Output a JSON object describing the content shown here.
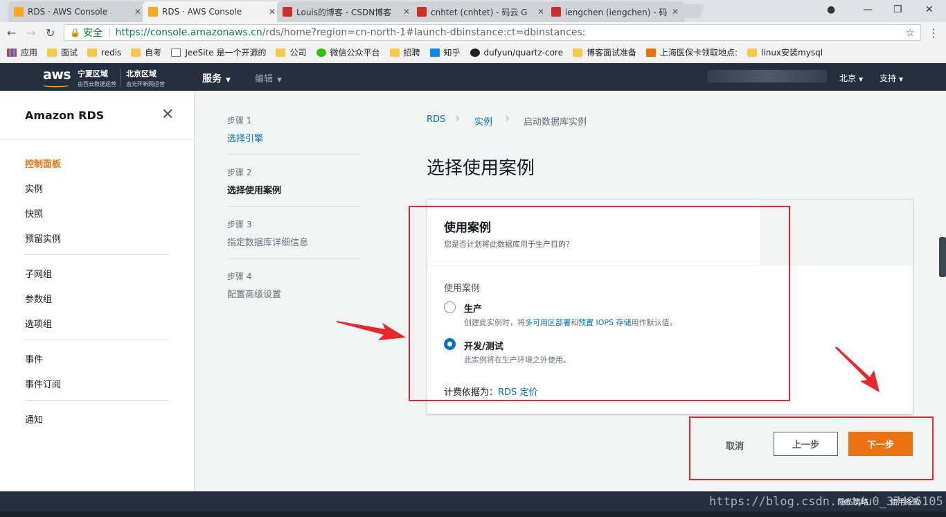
{
  "browser": {
    "tabs": [
      {
        "title": "RDS · AWS Console",
        "favicon": "#f9a825",
        "active": false
      },
      {
        "title": "RDS · AWS Console",
        "favicon": "#f9a825",
        "active": true
      },
      {
        "title": "Louis的博客 - CSDN博客",
        "favicon": "#c9302c",
        "active": false
      },
      {
        "title": "cnhtet (cnhtet) - 码云 G",
        "favicon": "#c9302c",
        "active": false
      },
      {
        "title": "iengchen (iengchen) - 码",
        "favicon": "#c9302c",
        "active": false
      }
    ],
    "secure_label": "安全",
    "url_host": "https://console.amazonaws.cn",
    "url_path": "/rds/home?region=cn-north-1#launch-dbinstance:ct=dbinstances:",
    "bookmarks": [
      {
        "label": "应用",
        "icon": "grid"
      },
      {
        "label": "面试",
        "icon": "folder"
      },
      {
        "label": "redis",
        "icon": "folder"
      },
      {
        "label": "自考",
        "icon": "folder"
      },
      {
        "label": "JeeSite 是一个开源的",
        "icon": "doc"
      },
      {
        "label": "公司",
        "icon": "folder"
      },
      {
        "label": "微信公众平台",
        "icon": "wechat"
      },
      {
        "label": "招聘",
        "icon": "folder"
      },
      {
        "label": "知乎",
        "icon": "zhi"
      },
      {
        "label": "dufyun/quartz-core",
        "icon": "gh"
      },
      {
        "label": "博客面试准备",
        "icon": "folder"
      },
      {
        "label": "上海医保卡领取地点:",
        "icon": "ho"
      },
      {
        "label": "linux安装mysql",
        "icon": "folder"
      }
    ]
  },
  "aws_header": {
    "logo": "aws",
    "region1_title": "宁夏区域",
    "region1_sub": "由西云数据运营",
    "region2_title": "北京区域",
    "region2_sub": "由光环新网运营",
    "services": "服务",
    "edit": "编辑",
    "region_menu": "北京",
    "support_menu": "支持"
  },
  "sidebar": {
    "title": "Amazon RDS",
    "items": [
      "控制面板",
      "实例",
      "快照",
      "预留实例",
      "子网组",
      "参数组",
      "选项组",
      "事件",
      "事件订阅",
      "通知"
    ]
  },
  "steps": [
    {
      "num": "步骤 1",
      "label": "选择引擎"
    },
    {
      "num": "步骤 2",
      "label": "选择使用案例"
    },
    {
      "num": "步骤 3",
      "label": "指定数据库详细信息"
    },
    {
      "num": "步骤 4",
      "label": "配置高级设置"
    }
  ],
  "breadcrumb": [
    "RDS",
    "实例",
    "启动数据库实例"
  ],
  "page_title": "选择使用案例",
  "card": {
    "title": "使用案例",
    "subtitle": "您是否计划将此数据库用于生产目的？",
    "field_label": "使用案例",
    "option1_title": "生产",
    "option1_desc_a": "创建此实例时，将",
    "option1_desc_link1": "多可用区部署",
    "option1_desc_b": "和",
    "option1_desc_link2": "预置 IOPS 存储",
    "option1_desc_c": "用作默认值。",
    "option2_title": "开发/测试",
    "option2_desc": "此实例将在生产环境之外使用。",
    "selected": "开发/测试",
    "billing_label": "计费依据为：",
    "billing_link": "RDS 定价"
  },
  "buttons": {
    "cancel": "取消",
    "prev": "上一步",
    "next": "下一步"
  },
  "footer": {
    "privacy": "隐私策略",
    "terms": "使用条款",
    "watermark": "https://blog.csdn.net/u0_37426105"
  },
  "colors": {
    "aws_nav": "#232f3e",
    "accent_orange": "#ec7211",
    "link_blue": "#0073bb",
    "annotation_red": "#e8262b"
  }
}
